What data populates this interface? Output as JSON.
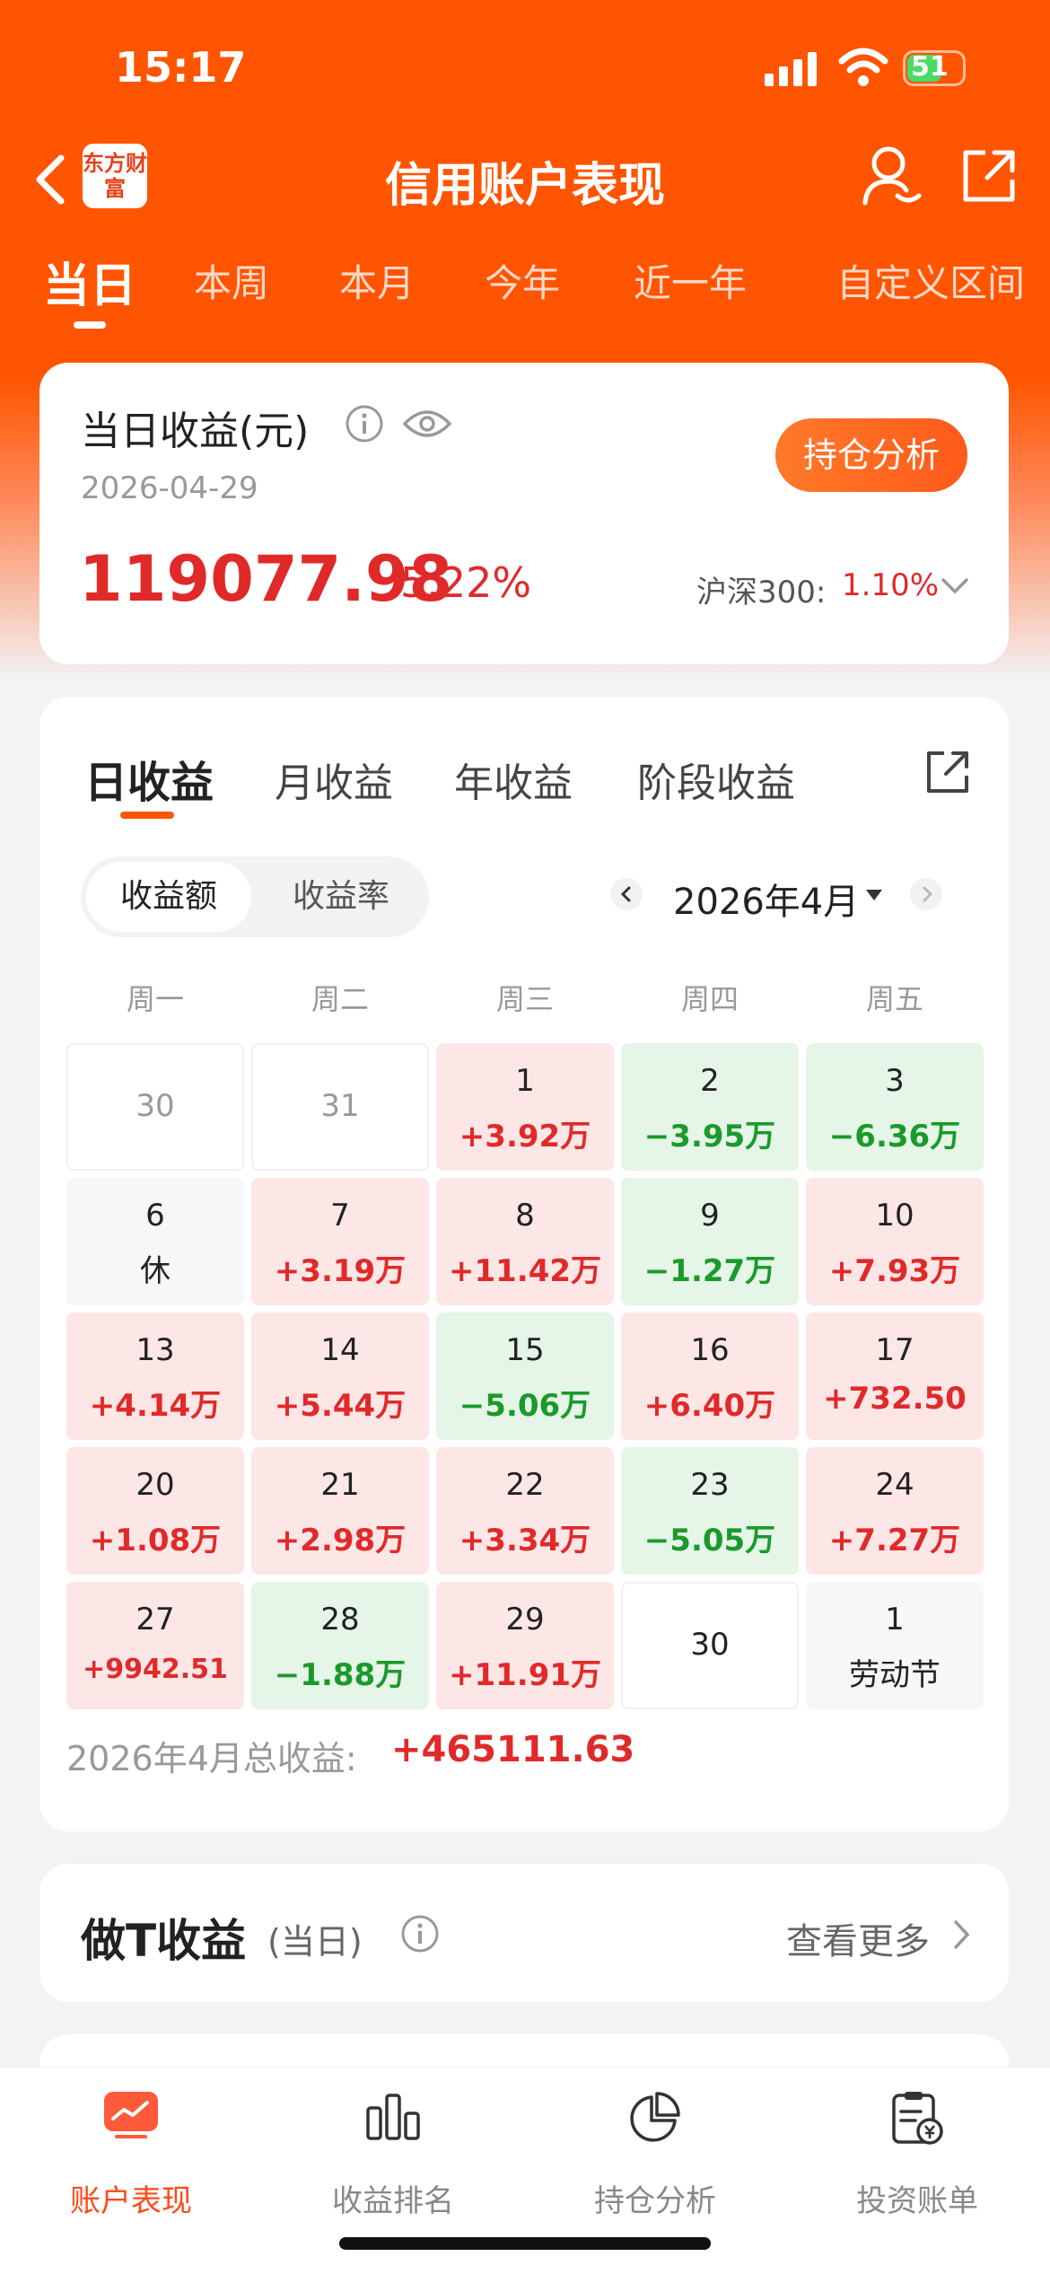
{
  "status_bar": {
    "time": "15:17",
    "battery": "51"
  },
  "header": {
    "logo": "东方财富",
    "title": "信用账户表现"
  },
  "period_tabs": [
    "当日",
    "本周",
    "本月",
    "今年",
    "近一年",
    "自定义区间"
  ],
  "summary": {
    "label": "当日收益(元)",
    "date": "2026-04-29",
    "amount": "119077.98",
    "percent": "5.22%",
    "button": "持仓分析",
    "index_label": "沪深300:",
    "index_value": "1.10%"
  },
  "calendar_tabs": [
    "日收益",
    "月收益",
    "年收益",
    "阶段收益"
  ],
  "toggle": {
    "left": "收益额",
    "right": "收益率"
  },
  "month": {
    "label": "2026年4月"
  },
  "weekdays": [
    "周一",
    "周二",
    "周三",
    "周四",
    "周五"
  ],
  "cells": [
    {
      "d": "30",
      "v": "",
      "t": "prev"
    },
    {
      "d": "31",
      "v": "",
      "t": "prev"
    },
    {
      "d": "1",
      "v": "+3.92万",
      "t": "up"
    },
    {
      "d": "2",
      "v": "−3.95万",
      "t": "down"
    },
    {
      "d": "3",
      "v": "−6.36万",
      "t": "down"
    },
    {
      "d": "6",
      "v": "休",
      "t": "rest"
    },
    {
      "d": "7",
      "v": "+3.19万",
      "t": "up"
    },
    {
      "d": "8",
      "v": "+11.42万",
      "t": "up"
    },
    {
      "d": "9",
      "v": "−1.27万",
      "t": "down"
    },
    {
      "d": "10",
      "v": "+7.93万",
      "t": "up"
    },
    {
      "d": "13",
      "v": "+4.14万",
      "t": "up"
    },
    {
      "d": "14",
      "v": "+5.44万",
      "t": "up"
    },
    {
      "d": "15",
      "v": "−5.06万",
      "t": "down"
    },
    {
      "d": "16",
      "v": "+6.40万",
      "t": "up"
    },
    {
      "d": "17",
      "v": "+732.50",
      "t": "up"
    },
    {
      "d": "20",
      "v": "+1.08万",
      "t": "up"
    },
    {
      "d": "21",
      "v": "+2.98万",
      "t": "up"
    },
    {
      "d": "22",
      "v": "+3.34万",
      "t": "up"
    },
    {
      "d": "23",
      "v": "−5.05万",
      "t": "down"
    },
    {
      "d": "24",
      "v": "+7.27万",
      "t": "up"
    },
    {
      "d": "27",
      "v": "+9942.51",
      "t": "up"
    },
    {
      "d": "28",
      "v": "−1.88万",
      "t": "down"
    },
    {
      "d": "29",
      "v": "+11.91万",
      "t": "up"
    },
    {
      "d": "30",
      "v": "",
      "t": "future"
    },
    {
      "d": "1",
      "v": "劳动节",
      "t": "rest"
    }
  ],
  "month_total": {
    "label": "2026年4月总收益:",
    "value": "+465111.63"
  },
  "t_card": {
    "title": "做T收益",
    "sub": "(当日)",
    "more": "查看更多"
  },
  "bottom_nav": [
    "账户表现",
    "收益排名",
    "持仓分析",
    "投资账单"
  ],
  "colors": {
    "brand": "#ff5500",
    "up": "#e02a2a",
    "down": "#1a9a2a"
  }
}
